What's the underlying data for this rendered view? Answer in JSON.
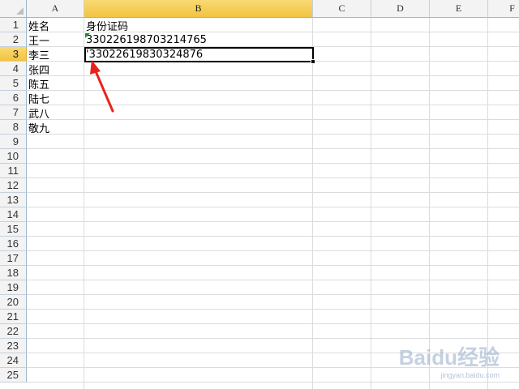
{
  "columns": [
    "A",
    "B",
    "C",
    "D",
    "E",
    "F"
  ],
  "selected_column": "B",
  "rows": [
    "1",
    "2",
    "3",
    "4",
    "5",
    "6",
    "7",
    "8",
    "9",
    "10",
    "11",
    "12",
    "13",
    "14",
    "15",
    "16",
    "17",
    "18",
    "19",
    "20",
    "21",
    "22",
    "23",
    "24",
    "25"
  ],
  "selected_row": "3",
  "cells": {
    "A1": "姓名",
    "B1": "身份证码",
    "A2": "王一",
    "B2": "330226198703214765",
    "A3": "李三",
    "B3": "'33022619830324876",
    "A4": "张四",
    "A5": "陈五",
    "A6": "陆七",
    "A7": "武八",
    "A8": "敬九"
  },
  "annotation": {
    "type": "arrow",
    "color": "#e8231c",
    "points_to": "B3"
  },
  "watermark": {
    "logo": "Baidu经验",
    "sub": "jingyan.baidu.com"
  }
}
